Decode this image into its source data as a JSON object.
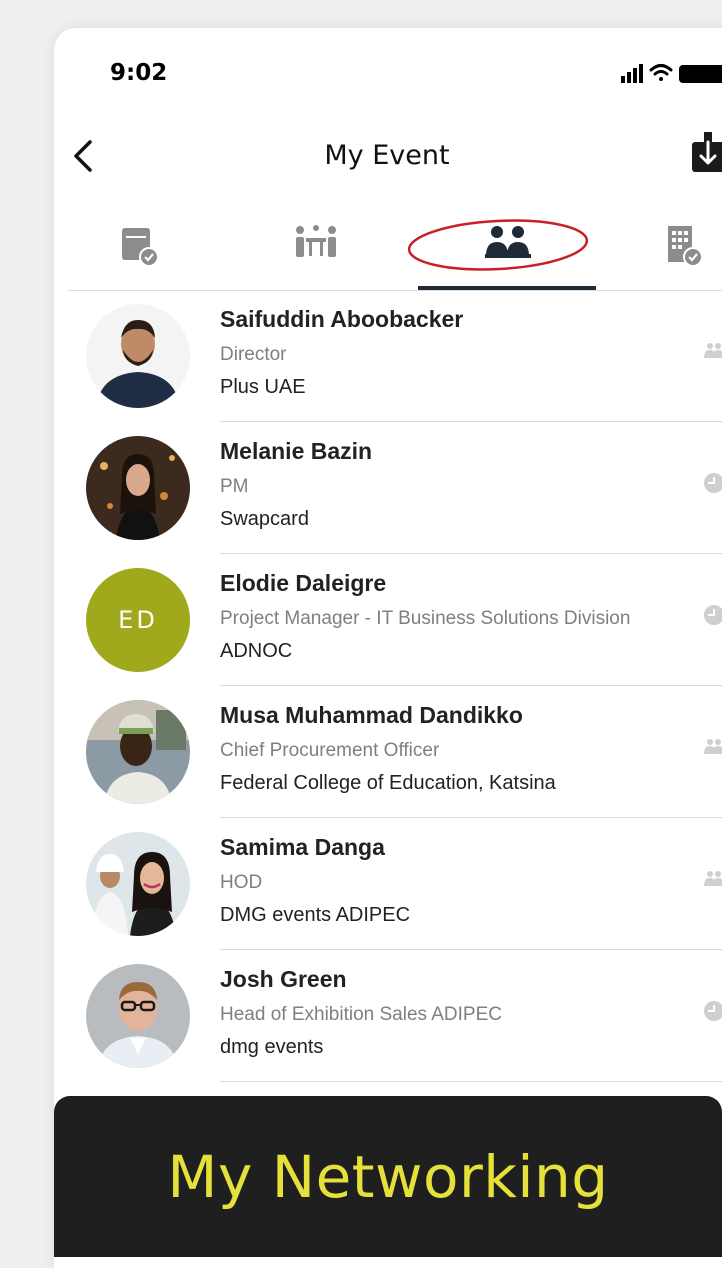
{
  "status_bar": {
    "time": "9:02"
  },
  "header": {
    "title": "My Event"
  },
  "tabs": [
    {
      "icon": "calendar-check-icon",
      "active": false
    },
    {
      "icon": "meeting-table-icon",
      "active": false
    },
    {
      "icon": "people-group-icon",
      "active": true
    },
    {
      "icon": "building-check-icon",
      "active": false
    }
  ],
  "contacts": [
    {
      "name": "Saifuddin Aboobacker",
      "role": "Director",
      "company": "Plus UAE",
      "avatar": "photo",
      "status_icon": "people-icon"
    },
    {
      "name": "Melanie Bazin",
      "role": "PM",
      "company": "Swapcard",
      "avatar": "photo",
      "status_icon": "clock-icon"
    },
    {
      "name": "Elodie Daleigre",
      "role": "Project Manager - IT Business Solutions Division",
      "company": "ADNOC",
      "avatar": "initials",
      "initials": "ED",
      "avatar_color": "#a0a81c",
      "status_icon": "clock-icon"
    },
    {
      "name": "Musa Muhammad Dandikko",
      "role": "Chief Procurement Officer",
      "company": "Federal College of Education, Katsina",
      "avatar": "photo",
      "status_icon": "people-icon"
    },
    {
      "name": "Samima Danga",
      "role": "HOD",
      "company": "DMG events ADIPEC",
      "avatar": "photo",
      "status_icon": "people-icon"
    },
    {
      "name": "Josh Green",
      "role": "Head of Exhibition Sales ADIPEC",
      "company": "dmg events",
      "avatar": "photo",
      "status_icon": "clock-icon"
    }
  ],
  "banner": {
    "text": "My Networking"
  },
  "colors": {
    "accent_ring": "#c8202a",
    "banner_bg": "#1f1f1f",
    "banner_text": "#e5e13a",
    "tab_underline": "#1e2a36"
  }
}
